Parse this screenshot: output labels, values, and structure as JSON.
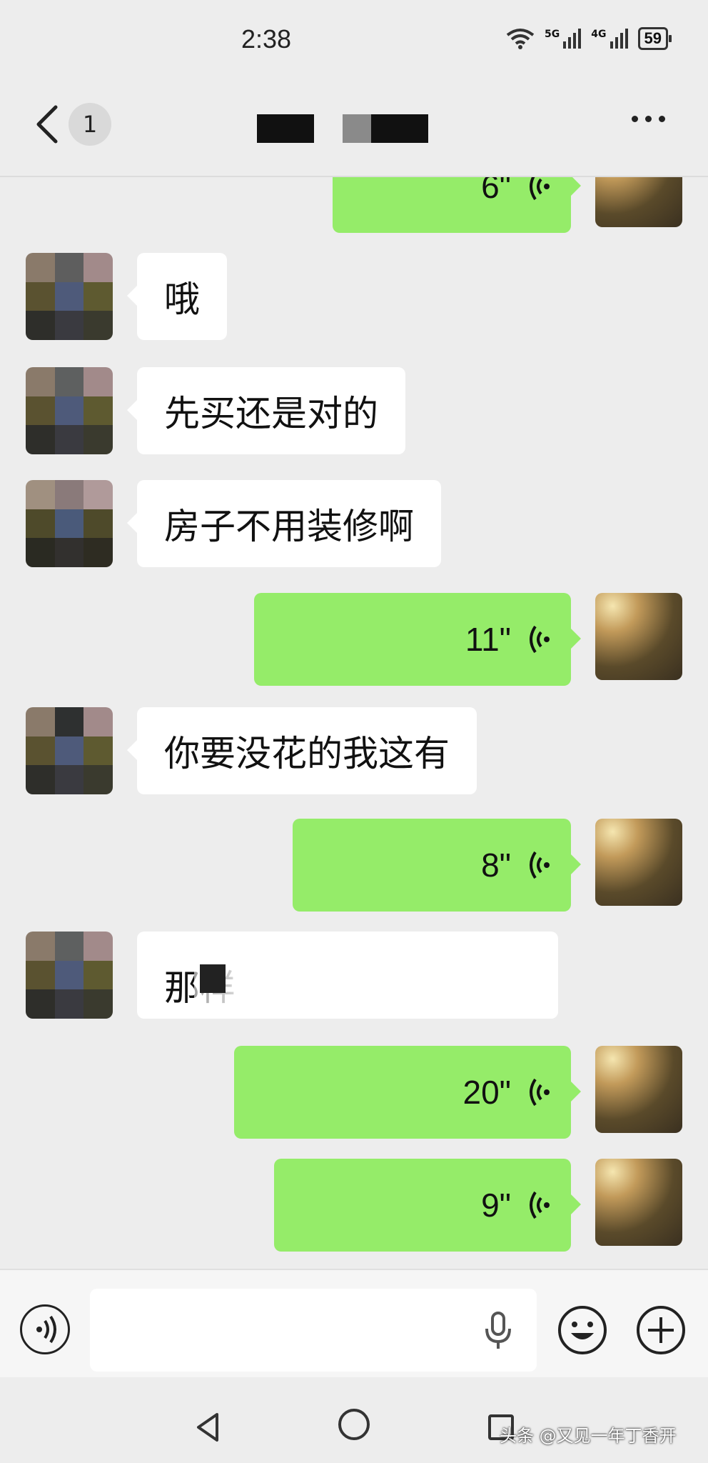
{
  "status_bar": {
    "time": "2:38",
    "signal1_label": "5G",
    "signal2_label": "4G",
    "battery": "59"
  },
  "header": {
    "unread_count": "1"
  },
  "messages": [
    {
      "side": "right",
      "duration": "6\""
    },
    {
      "side": "left",
      "text": "哦"
    },
    {
      "side": "left",
      "text": "先买还是对的"
    },
    {
      "side": "left",
      "text": "房子不用装修啊"
    },
    {
      "side": "right",
      "duration": "11\""
    },
    {
      "side": "left",
      "text": "你要没花的我这有"
    },
    {
      "side": "right",
      "duration": "8\""
    },
    {
      "side": "left",
      "text": "那样"
    },
    {
      "side": "right",
      "duration": "20\""
    },
    {
      "side": "right",
      "duration": "9\""
    }
  ],
  "input": {
    "placeholder": ""
  },
  "watermark": "头条 @又见一年丁香开",
  "colors": {
    "background": "#ededed",
    "my_bubble": "#95ec69",
    "their_bubble": "#ffffff"
  }
}
